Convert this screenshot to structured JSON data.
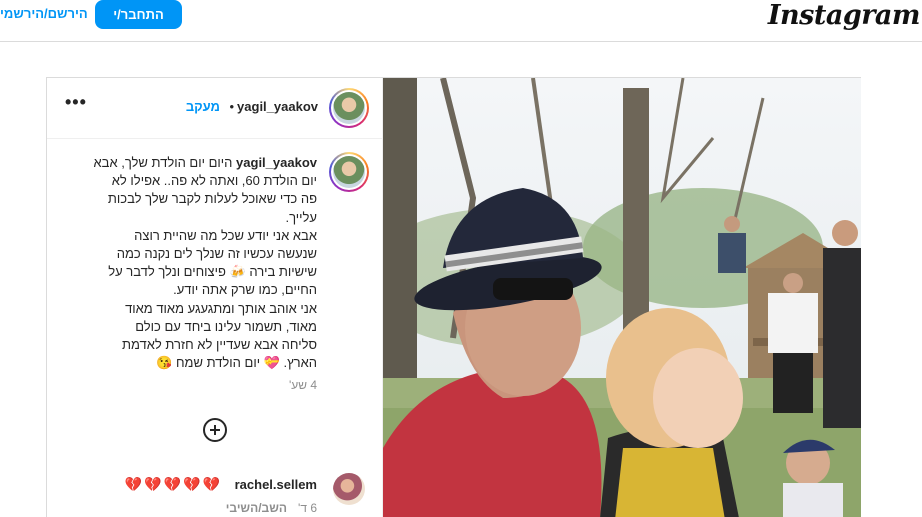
{
  "topbar": {
    "logo": "Instagram",
    "login_label": "התחבר/י",
    "signup_label": "הירשם/הירשמי"
  },
  "post": {
    "username": "yagil_yaakov",
    "separator": "•",
    "follow_label": "מעקב",
    "more_label": "•••",
    "caption": {
      "username": "yagil_yaakov",
      "text_lines": [
        " היום יום הולדת שלך, אבא",
        "יום הולדת 60, ואתה לא פה.. אפילו לא",
        "פה כדי שאוכל לעלות לקבר שלך לבכות",
        "עלייך.",
        "אבא אני יודע שכל מה שהיית רוצה",
        "שנעשה עכשיו זה שנלך לים נקנה כמה",
        "שישיות בירה 🍻 פיצוחים ונלך לדבר על",
        "החיים, כמו שרק אתה יודע.",
        "אני אוהב אותך ומתגעגע מאוד מאוד",
        "מאוד, תשמור עלינו ביחד עם כולם",
        "סליחה אבא שעדיין לא חזרת לאדמת",
        "הארץ. 💝 יום הולדת שמח 😘"
      ],
      "time": "4 שע'"
    },
    "comment": {
      "username": "rachel.sellem",
      "text": "💔💔💔💔💔",
      "time": "6 ד'",
      "reply_label": "השב/השיבי"
    }
  },
  "colors": {
    "accent": "#0095f6",
    "border": "#dbdbdb",
    "text": "#262626",
    "muted": "#8e8e8e"
  }
}
